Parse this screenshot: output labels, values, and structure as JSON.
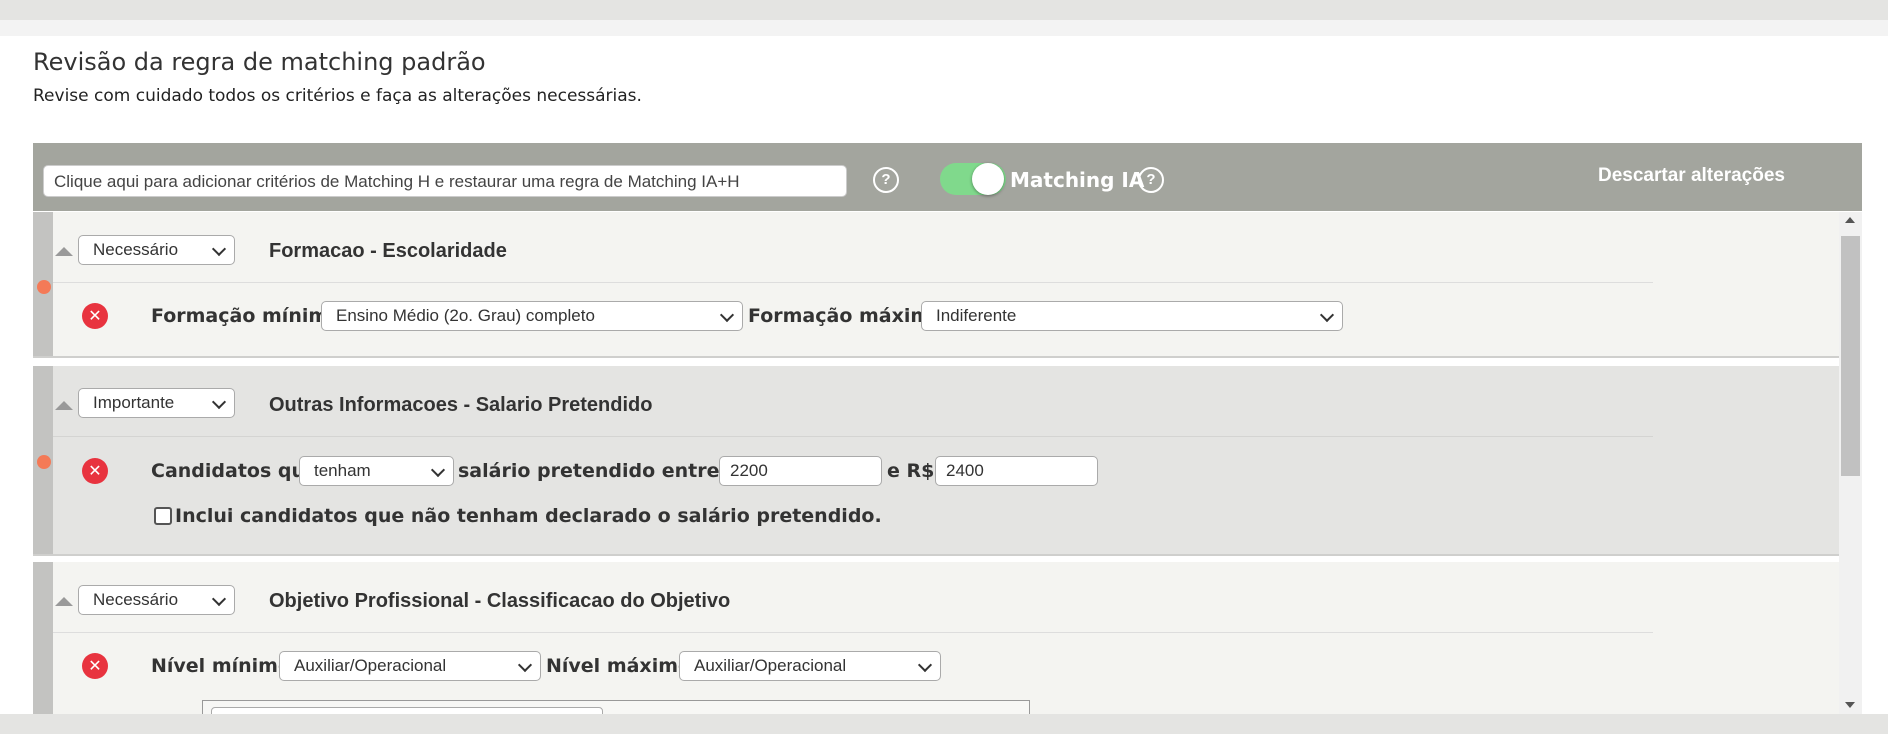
{
  "header": {
    "title": "Revisão da regra de matching padrão",
    "subtitle": "Revise com cuidado todos os critérios e faça as alterações necessárias."
  },
  "toolbar": {
    "search_placeholder": "Clique aqui para adicionar critérios de Matching H e restaurar uma regra de Matching IA+H",
    "help_icon": "?",
    "toggle_label": "Matching IA",
    "toggle_on": true,
    "discard_label": "Descartar alterações"
  },
  "sections": [
    {
      "priority": "Necessário",
      "title": "Formacao - Escolaridade",
      "remove_icon": "✕",
      "min_label": "Formação mínima",
      "min_value": "Ensino Médio (2o. Grau) completo",
      "max_label": "Formação máxima",
      "max_value": "Indiferente"
    },
    {
      "priority": "Importante",
      "title": "Outras Informacoes - Salario Pretendido",
      "remove_icon": "✕",
      "prefix_label": "Candidatos que",
      "condition_value": "tenham",
      "range_label": "salário pretendido entre R$",
      "from_value": "2200",
      "and_label": "e R$",
      "to_value": "2400",
      "checkbox_label": "Inclui candidatos que não tenham declarado o salário pretendido.",
      "checkbox_checked": false
    },
    {
      "priority": "Necessário",
      "title": "Objetivo Profissional - Classificacao do Objetivo",
      "remove_icon": "✕",
      "min_label": "Nível mínimo",
      "min_value": "Auxiliar/Operacional",
      "max_label": "Nível máximo",
      "max_value": "Auxiliar/Operacional"
    }
  ],
  "colors": {
    "toolbar_bg": "#a3a59e",
    "toggle_on": "#80d98c",
    "remove_red": "#e8333f",
    "marker_orange": "#f47a57"
  }
}
